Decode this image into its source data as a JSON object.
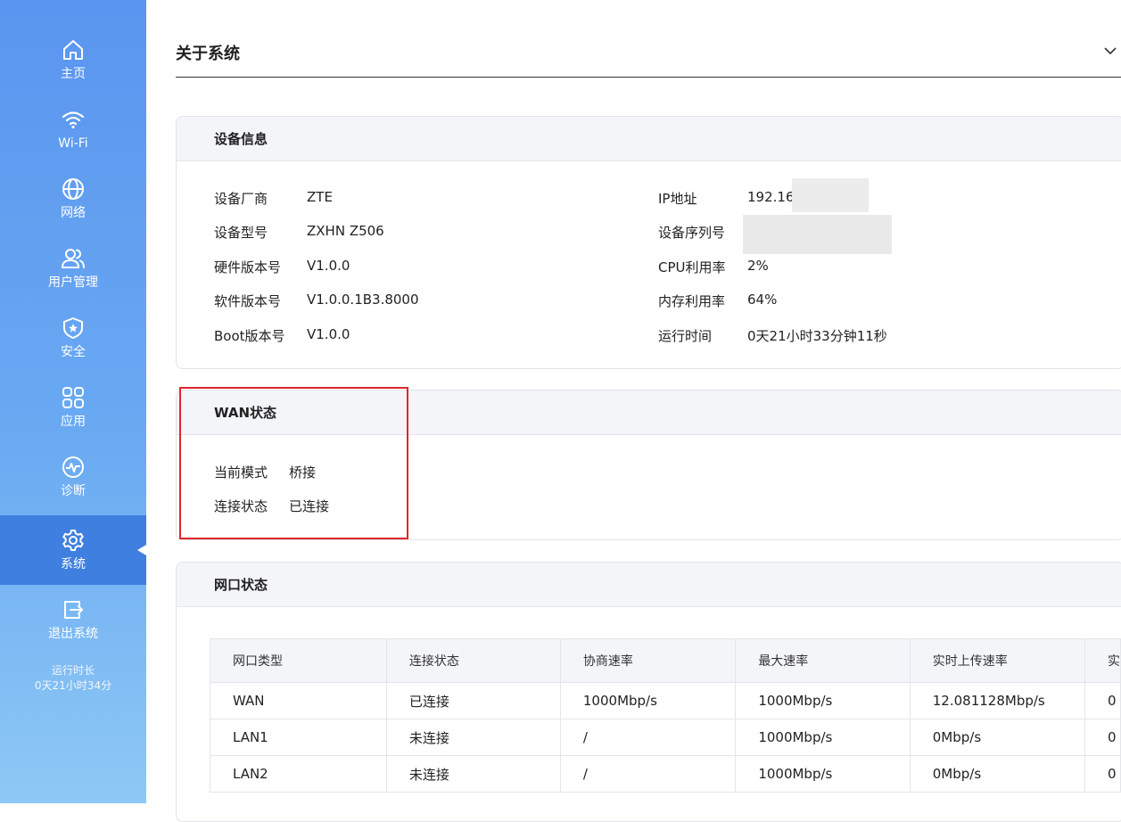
{
  "sidebar": {
    "items": [
      {
        "label": "主页",
        "icon": "home-icon"
      },
      {
        "label": "Wi-Fi",
        "icon": "wifi-icon"
      },
      {
        "label": "网络",
        "icon": "globe-icon"
      },
      {
        "label": "用户管理",
        "icon": "users-icon"
      },
      {
        "label": "安全",
        "icon": "shield-icon"
      },
      {
        "label": "应用",
        "icon": "apps-icon"
      },
      {
        "label": "诊断",
        "icon": "diagnose-icon"
      },
      {
        "label": "系统",
        "icon": "gear-icon",
        "active": true
      },
      {
        "label": "退出系统",
        "icon": "logout-icon"
      }
    ],
    "uptime_label": "运行时长",
    "uptime_value": "0天21小时34分"
  },
  "page": {
    "title": "关于系统",
    "collapse_icon": "chevron-down-icon"
  },
  "device_info": {
    "title": "设备信息",
    "left": [
      {
        "key": "设备厂商",
        "value": "ZTE"
      },
      {
        "key": "设备型号",
        "value": "ZXHN Z506"
      },
      {
        "key": "硬件版本号",
        "value": "V1.0.0"
      },
      {
        "key": "软件版本号",
        "value": "V1.0.0.1B3.8000"
      },
      {
        "key": "Boot版本号",
        "value": "V1.0.0"
      }
    ],
    "right": [
      {
        "key": "IP地址",
        "value": "192.168"
      },
      {
        "key": "设备序列号",
        "value": ""
      },
      {
        "key": "CPU利用率",
        "value": "2%"
      },
      {
        "key": "内存利用率",
        "value": "64%"
      },
      {
        "key": "运行时间",
        "value": "0天21小时33分钟11秒"
      }
    ]
  },
  "wan_status": {
    "title": "WAN状态",
    "rows": [
      {
        "key": "当前模式",
        "value": "桥接"
      },
      {
        "key": "连接状态",
        "value": "已连接"
      }
    ]
  },
  "port_status": {
    "title": "网口状态",
    "columns": [
      "网口类型",
      "连接状态",
      "协商速率",
      "最大速率",
      "实时上传速率",
      "实"
    ],
    "rows": [
      [
        "WAN",
        "已连接",
        "1000Mbp/s",
        "1000Mbp/s",
        "12.081128Mbp/s",
        "0"
      ],
      [
        "LAN1",
        "未连接",
        "/",
        "1000Mbp/s",
        "0Mbp/s",
        "0"
      ],
      [
        "LAN2",
        "未连接",
        "/",
        "1000Mbp/s",
        "0Mbp/s",
        "0"
      ]
    ]
  },
  "colors": {
    "sidebar_top": "#5a95ef",
    "sidebar_active": "#3f7fe0",
    "highlight_border": "#e0262b"
  }
}
